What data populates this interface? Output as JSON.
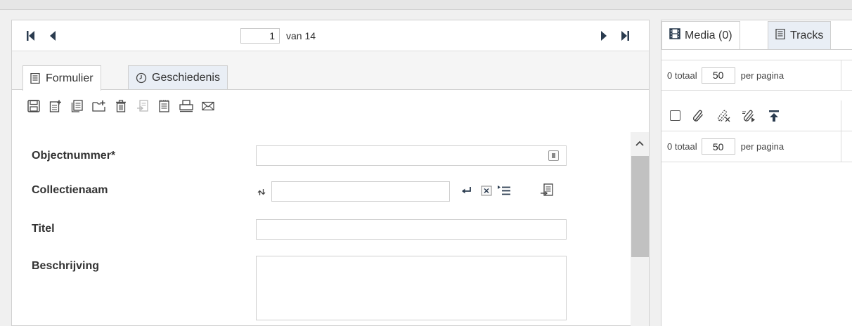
{
  "pager": {
    "current_page": "1",
    "of_text": "van 14",
    "first_icon": "first-page-icon",
    "prev_icon": "prev-page-icon",
    "next_icon": "next-page-icon",
    "last_icon": "last-page-icon"
  },
  "tabs": [
    {
      "label": "Formulier",
      "icon": "form-icon",
      "active": true
    },
    {
      "label": "Geschiedenis",
      "icon": "history-icon",
      "active": false
    }
  ],
  "toolbar": {
    "icons": [
      "save-icon",
      "new-record-icon",
      "copy-record-icon",
      "new-folder-icon",
      "delete-icon",
      "import-icon",
      "document-icon",
      "print-icon",
      "email-icon"
    ]
  },
  "form": {
    "objectnummer_label": "Objectnummer*",
    "objectnummer_value": "",
    "collectienaam_label": "Collectienaam",
    "collectienaam_value": "",
    "titel_label": "Titel",
    "titel_value": "",
    "beschrijving_label": "Beschrijving",
    "beschrijving_value": ""
  },
  "right": {
    "tabs": [
      {
        "label": "Media (0)",
        "icon": "film-icon",
        "active": true
      },
      {
        "label": "Tracks",
        "icon": "list-icon",
        "active": false
      }
    ],
    "row1": {
      "total": "0 totaal",
      "per_page_value": "50",
      "per_page_label": "per pagina"
    },
    "row2": {
      "total": "0 totaal",
      "per_page_value": "50",
      "per_page_label": "per pagina"
    },
    "media_tools": [
      "select-all-checkbox",
      "attach-icon",
      "detach-icon",
      "edit-link-icon",
      "upload-icon"
    ]
  },
  "colors": {
    "accent": "#2a3b4f",
    "tab_inactive": "#e9eef5",
    "border": "#cfcfcf",
    "scroll_thumb": "#c1c1c1"
  }
}
